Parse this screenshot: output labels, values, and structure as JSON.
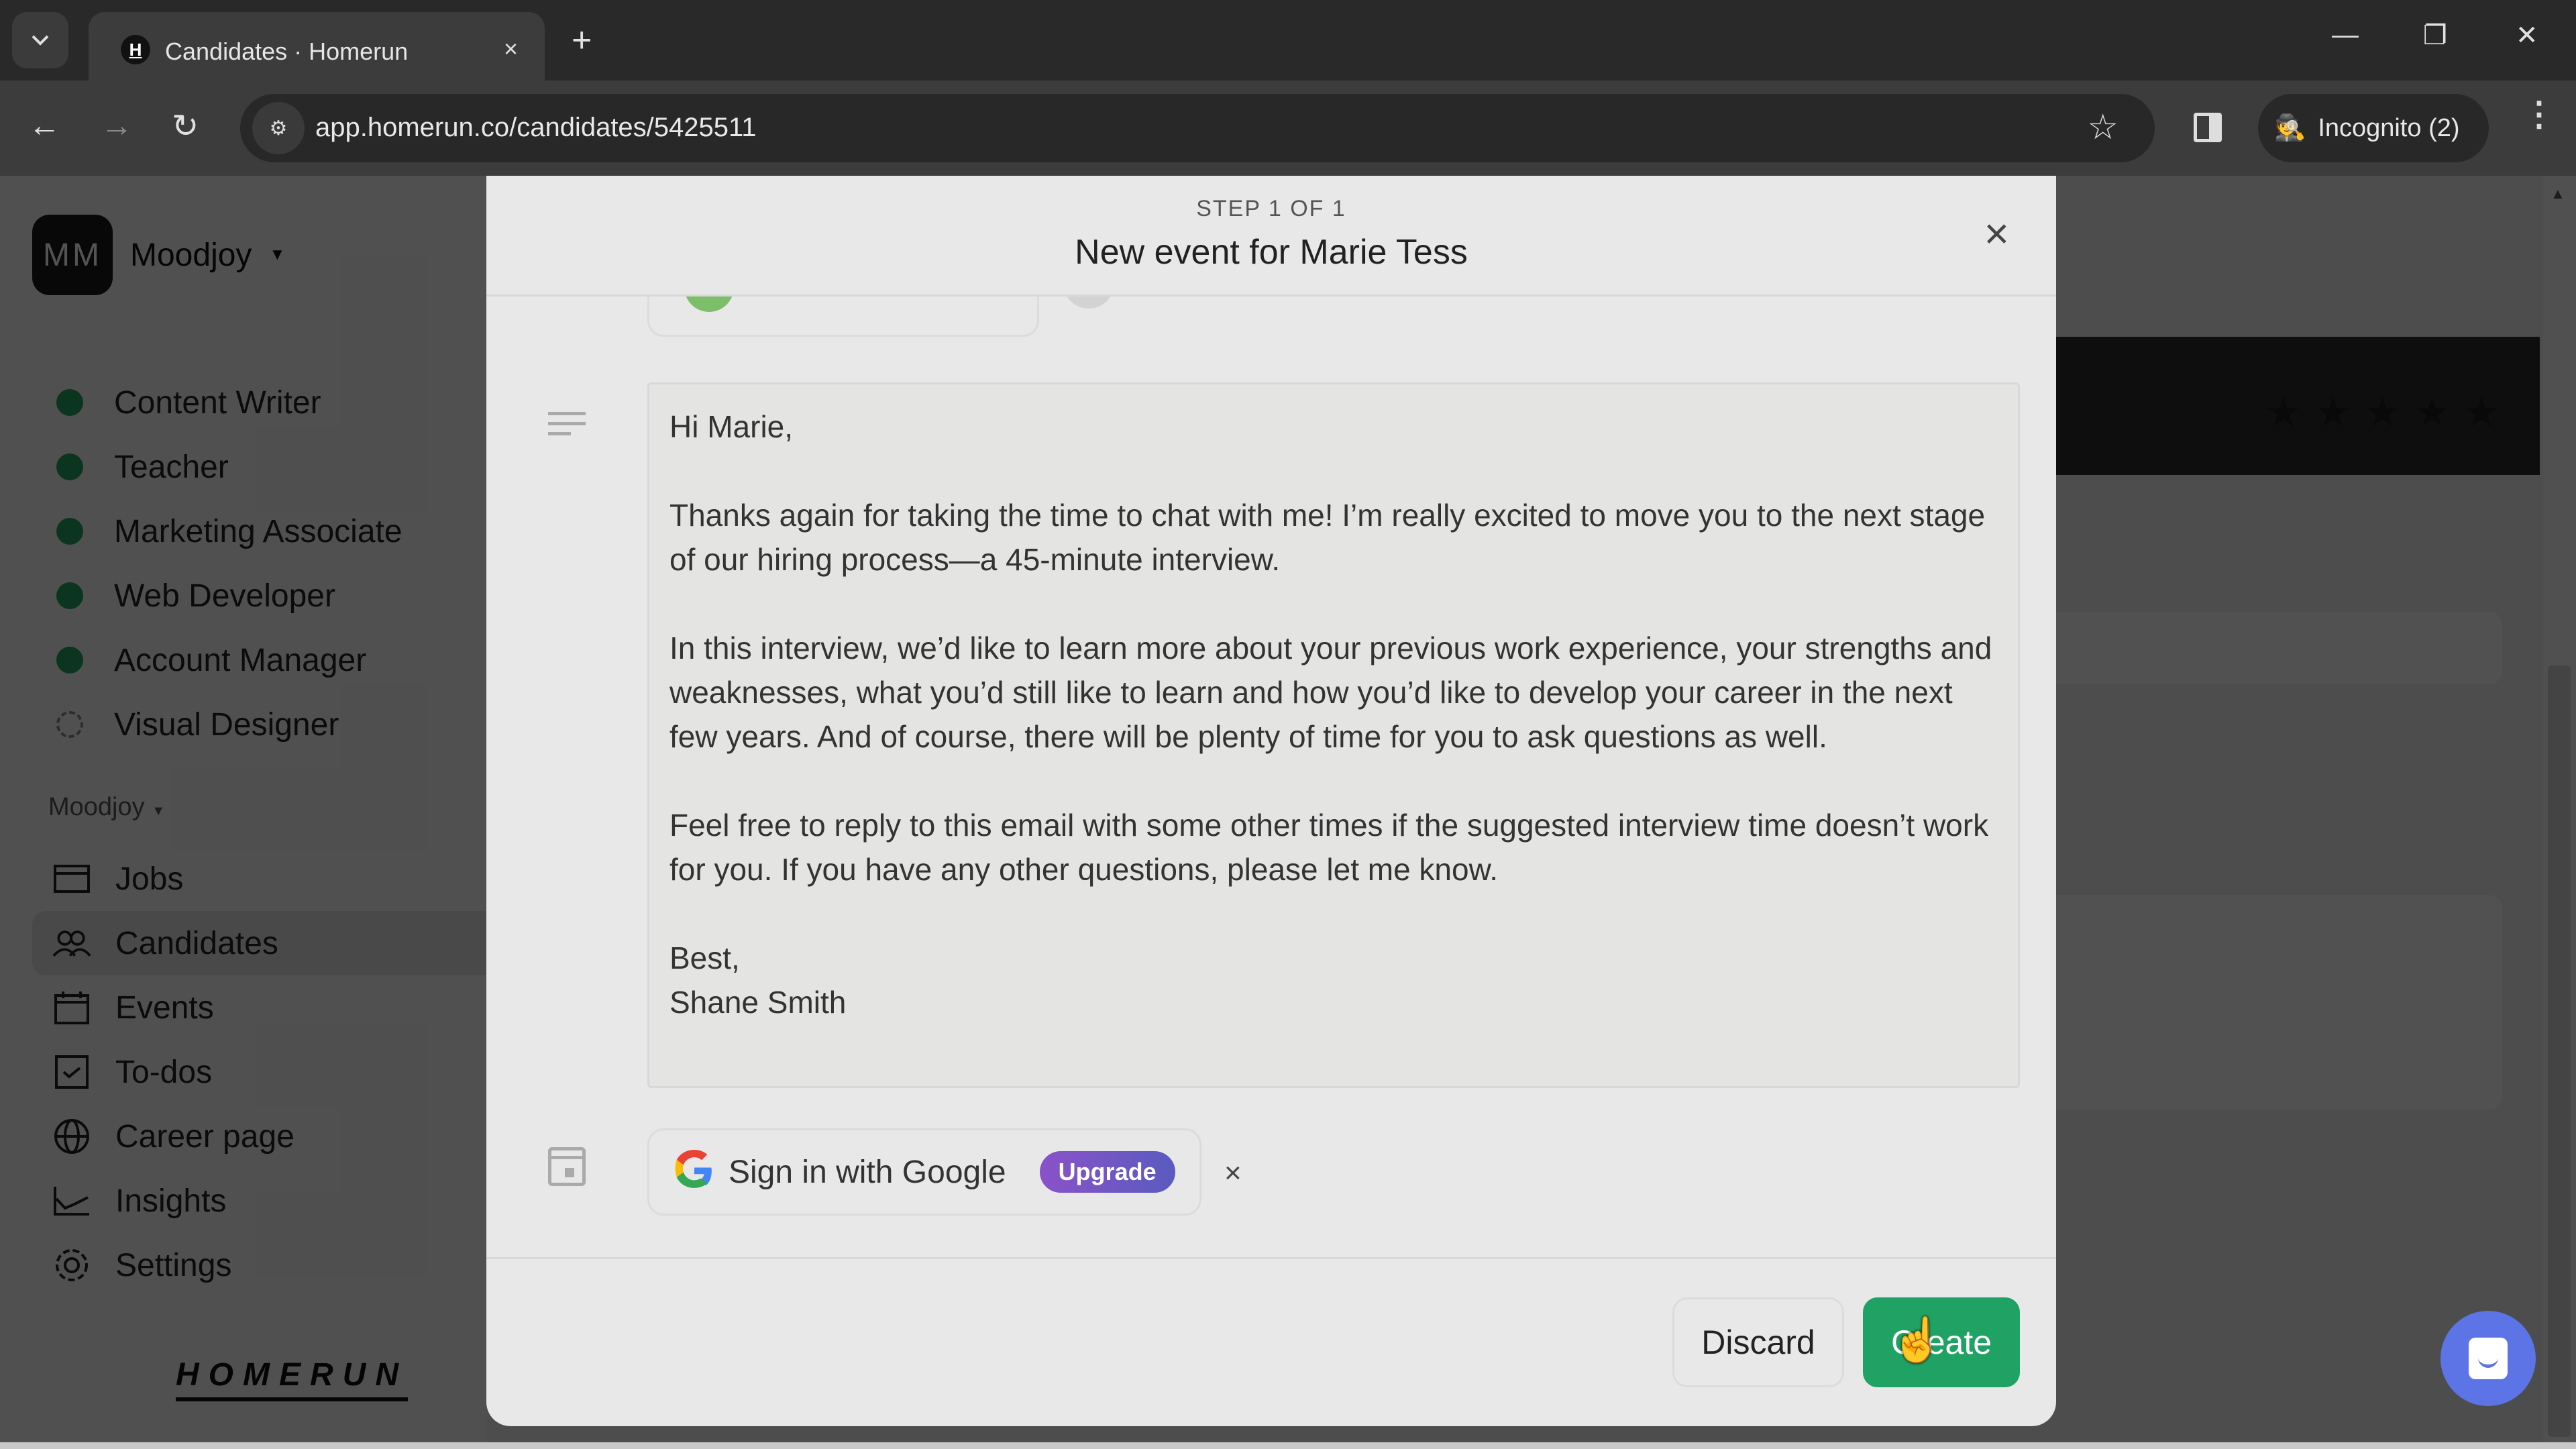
{
  "browser": {
    "tab_title": "Candidates · Homerun",
    "favicon_letter": "H",
    "url": "app.homerun.co/candidates/5425511",
    "incognito_label": "Incognito (2)",
    "icons": {
      "tab_search": "chevron-down-icon",
      "tab_close": "×",
      "new_tab": "+",
      "minimize": "—",
      "restore": "❐",
      "close": "✕",
      "back": "←",
      "forward": "→",
      "reload": "↻",
      "site_info": "⚙",
      "bookmark": "☆",
      "incognito": "🕵",
      "menu": "⋮"
    }
  },
  "sidebar": {
    "workspace_initials": "MM",
    "workspace_name": "Moodjoy",
    "jobs": [
      {
        "label": "Content Writer",
        "status": "published"
      },
      {
        "label": "Teacher",
        "status": "published"
      },
      {
        "label": "Marketing Associate",
        "status": "published"
      },
      {
        "label": "Web Developer",
        "status": "published"
      },
      {
        "label": "Account Manager",
        "status": "published"
      },
      {
        "label": "Visual Designer",
        "status": "draft"
      }
    ],
    "section_label": "Moodjoy",
    "nav": [
      {
        "label": "Jobs",
        "icon": "jobs-icon",
        "active": false
      },
      {
        "label": "Candidates",
        "icon": "candidates-icon",
        "active": true
      },
      {
        "label": "Events",
        "icon": "calendar-icon",
        "active": false
      },
      {
        "label": "To-dos",
        "icon": "checkbox-icon",
        "active": false
      },
      {
        "label": "Career page",
        "icon": "globe-icon",
        "active": false
      },
      {
        "label": "Insights",
        "icon": "chart-icon",
        "active": false
      },
      {
        "label": "Settings",
        "icon": "gear-icon",
        "active": false
      }
    ],
    "brand": "HOMERUN"
  },
  "background": {
    "rating_stars": 5,
    "rating_filled": 0
  },
  "modal": {
    "step": "STEP 1 OF 1",
    "title": "New event for Marie Tess",
    "close_icon": "×",
    "email_body": {
      "greeting": "Hi Marie,",
      "p1": "Thanks again for taking the time to chat with me! I’m really excited to move you to the next stage of our hiring process—a 45-minute interview.",
      "p2": "In this interview, we’d like to learn more about your previous work experience, your strengths and weaknesses, what you’d still like to learn and how you’d like to develop your career in the next few years. And of course, there will be plenty of time for you to ask questions as well.",
      "p3": "Feel free to reply to this email with some other times if the suggested interview time doesn’t work for you. If you have any other questions, please let me know.",
      "signoff": "Best,",
      "signature": "Shane Smith"
    },
    "google_signin_label": "Sign in with Google",
    "upgrade_badge": "Upgrade",
    "dismiss_icon": "×",
    "discard_label": "Discard",
    "create_label": "Create"
  },
  "colors": {
    "create_green": "#21a265",
    "upgrade_purple": "#8a52c8",
    "chat_blue": "#5c74e6",
    "job_dot_green": "#24a060"
  }
}
